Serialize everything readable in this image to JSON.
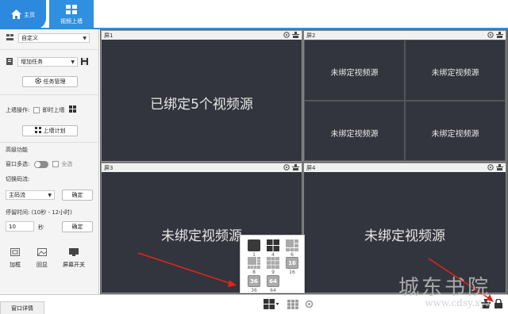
{
  "header": {
    "home_label": "主页",
    "video_wall_label": "视频上墙"
  },
  "left": {
    "layout_select": "自定义",
    "task_select": "增加任务",
    "task_manage_button": "任务管理",
    "wall_op_label": "上墙操作:",
    "instant_wall_label": "即时上墙",
    "wall_plan_button": "上墙计划",
    "advanced_label": "高级功能",
    "multi_select_label": "窗口多选:",
    "select_all_label": "全选",
    "switch_stream_label": "切换码流:",
    "stream_select": "主码流",
    "confirm_label_1": "确定",
    "dwell_label": "停留时间: (10秒 - 12小时)",
    "dwell_value": "10",
    "dwell_unit": "秒",
    "confirm_label_2": "确定",
    "tools": [
      "加框",
      "回显",
      "屏幕开关"
    ]
  },
  "screens": [
    {
      "title": "屏1",
      "label": "已绑定5个视频源"
    },
    {
      "title": "屏2",
      "label": "未绑定视频源"
    },
    {
      "title": "屏3",
      "label": "未绑定视频源"
    },
    {
      "title": "屏4",
      "label": "未绑定视频源"
    }
  ],
  "layout_popup": {
    "options": [
      "1",
      "4",
      "6",
      "8",
      "9",
      "16",
      "36",
      "64"
    ],
    "badge_16": "16",
    "badge_36": "36",
    "badge_64": "64"
  },
  "bottom": {
    "window_detail_tab": "窗口详情"
  },
  "watermark": {
    "line1": "城东书院",
    "line2": "www.cdsy.xyz"
  },
  "colors": {
    "accent": "#2f8fe0",
    "screen_bg": "#32353d",
    "annotation_arrow": "#e0241b"
  }
}
